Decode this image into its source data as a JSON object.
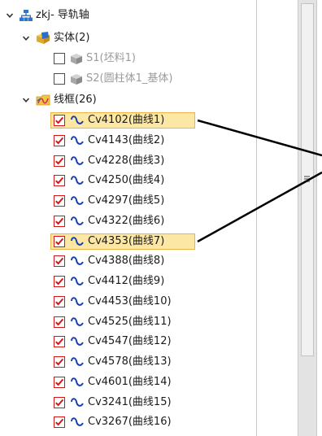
{
  "tree": {
    "root": {
      "label": "zkj- 导轨轴",
      "icon": "assembly-tree-icon",
      "expanded": true
    },
    "solids_group": {
      "label": "实体(2)",
      "icon": "solid-body-folder-icon",
      "expanded": true,
      "items": [
        {
          "label": "S1(坯料1)",
          "checked": false,
          "icon": "solid-cube-icon"
        },
        {
          "label": "S2(圆柱体1_基体)",
          "checked": false,
          "icon": "solid-cube-icon"
        }
      ]
    },
    "wireframe_group": {
      "label": "线框(26)",
      "icon": "wireframe-folder-icon",
      "expanded": true,
      "items": [
        {
          "label": "Cv4102(曲线1)",
          "checked": true,
          "selected": true
        },
        {
          "label": "Cv4143(曲线2)",
          "checked": true,
          "selected": false
        },
        {
          "label": "Cv4228(曲线3)",
          "checked": true,
          "selected": false
        },
        {
          "label": "Cv4250(曲线4)",
          "checked": true,
          "selected": false
        },
        {
          "label": "Cv4297(曲线5)",
          "checked": true,
          "selected": false
        },
        {
          "label": "Cv4322(曲线6)",
          "checked": true,
          "selected": false
        },
        {
          "label": "Cv4353(曲线7)",
          "checked": true,
          "selected": true
        },
        {
          "label": "Cv4388(曲线8)",
          "checked": true,
          "selected": false
        },
        {
          "label": "Cv4412(曲线9)",
          "checked": true,
          "selected": false
        },
        {
          "label": "Cv4453(曲线10)",
          "checked": true,
          "selected": false
        },
        {
          "label": "Cv4525(曲线11)",
          "checked": true,
          "selected": false
        },
        {
          "label": "Cv4547(曲线12)",
          "checked": true,
          "selected": false
        },
        {
          "label": "Cv4578(曲线13)",
          "checked": true,
          "selected": false
        },
        {
          "label": "Cv4601(曲线14)",
          "checked": true,
          "selected": false
        },
        {
          "label": "Cv3241(曲线15)",
          "checked": true,
          "selected": false
        },
        {
          "label": "Cv3267(曲线16)",
          "checked": true,
          "selected": false
        }
      ]
    }
  },
  "colors": {
    "selection_fill": "#fde7a4",
    "selection_border": "#ecb54a",
    "check_red": "#d01818",
    "curve_icon_blue": "#1a3fb0",
    "disabled_text": "#9b9b9b"
  }
}
